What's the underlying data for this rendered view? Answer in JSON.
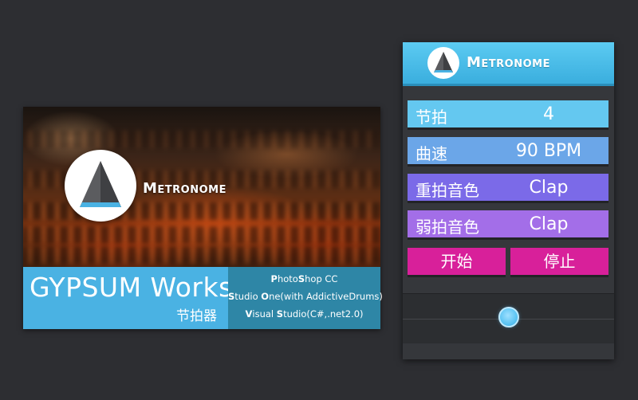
{
  "promo": {
    "brand": "Metronome",
    "title": "GYPSUM Works",
    "subtitle": "节拍器",
    "tools": [
      {
        "prefix": "P",
        "mid1": "hoto",
        "s": "S",
        "rest": "hop CC"
      },
      {
        "prefix": "S",
        "mid1": "tudio ",
        "s": "O",
        "rest": "ne(with AddictiveDrums)"
      },
      {
        "prefix": "V",
        "mid1": "isual ",
        "s": "S",
        "rest": "tudio(C#,.net2.0)"
      }
    ]
  },
  "app": {
    "title": "Metronome",
    "rows": {
      "beats": {
        "label": "节拍",
        "value": "4"
      },
      "tempo": {
        "label": "曲速",
        "value": "90 BPM"
      },
      "accent": {
        "label": "重拍音色",
        "value": "Clap"
      },
      "weak": {
        "label": "弱拍音色",
        "value": "Clap"
      }
    },
    "buttons": {
      "start": "开始",
      "stop": "停止"
    },
    "slider": {
      "position": 0.5
    }
  },
  "colors": {
    "background": "#2d2e32",
    "accent_blue": "#4ab2e3",
    "beats_row": "#64c8f0",
    "tempo_row": "#6ba6e8",
    "accent_row": "#7b6ae8",
    "weak_row": "#a36ee8",
    "button": "#d8209a"
  },
  "icons": {
    "logo": "metronome-triangle-icon",
    "knob": "slider-knob"
  }
}
